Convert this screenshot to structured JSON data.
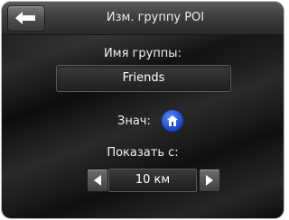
{
  "header": {
    "title": "Изм. группу POI",
    "back_icon": "arrow-left-icon"
  },
  "group_name": {
    "label": "Имя группы:",
    "value": "Friends"
  },
  "icon_setting": {
    "label": "Знач:",
    "icon": "house-poi-icon",
    "color": "#2a5fe6"
  },
  "show_from": {
    "label": "Показать с:",
    "value": "10 км",
    "prev_icon": "triangle-left-icon",
    "next_icon": "triangle-right-icon"
  }
}
